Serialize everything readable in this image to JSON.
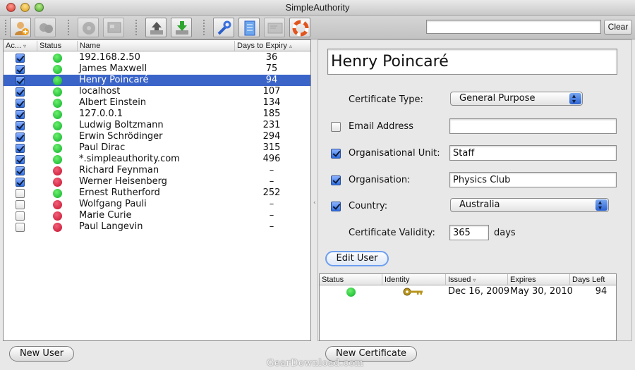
{
  "window": {
    "title": "SimpleAuthority"
  },
  "toolbar": {
    "buttons": [
      {
        "icon": "new-user-icon"
      },
      {
        "icon": "users-disabled-icon"
      },
      {
        "icon": "disk-disabled-icon"
      },
      {
        "icon": "screen-disabled-icon"
      },
      {
        "icon": "upload-icon"
      },
      {
        "icon": "download-icon"
      },
      {
        "icon": "tools-icon"
      },
      {
        "icon": "certificate-scroll-icon"
      },
      {
        "icon": "certificate-card-icon"
      },
      {
        "icon": "lifebuoy-help-icon"
      }
    ],
    "search_value": "",
    "clear_label": "Clear"
  },
  "users_table": {
    "columns": [
      "Ac...",
      "Status",
      "Name",
      "Days to Expiry"
    ],
    "rows": [
      {
        "active": true,
        "status": "green",
        "name": "192.168.2.50",
        "days": "36",
        "selected": false
      },
      {
        "active": true,
        "status": "green",
        "name": "James Maxwell",
        "days": "75",
        "selected": false
      },
      {
        "active": true,
        "status": "green",
        "name": "Henry Poincaré",
        "days": "94",
        "selected": true
      },
      {
        "active": true,
        "status": "green",
        "name": "localhost",
        "days": "107",
        "selected": false
      },
      {
        "active": true,
        "status": "green",
        "name": "Albert Einstein",
        "days": "134",
        "selected": false
      },
      {
        "active": true,
        "status": "green",
        "name": "127.0.0.1",
        "days": "185",
        "selected": false
      },
      {
        "active": true,
        "status": "green",
        "name": "Ludwig Boltzmann",
        "days": "231",
        "selected": false
      },
      {
        "active": true,
        "status": "green",
        "name": "Erwin Schrödinger",
        "days": "294",
        "selected": false
      },
      {
        "active": true,
        "status": "green",
        "name": "Paul Dirac",
        "days": "315",
        "selected": false
      },
      {
        "active": true,
        "status": "green",
        "name": "*.simpleauthority.com",
        "days": "496",
        "selected": false
      },
      {
        "active": true,
        "status": "red",
        "name": "Richard Feynman",
        "days": "–",
        "selected": false
      },
      {
        "active": true,
        "status": "red",
        "name": "Werner Heisenberg",
        "days": "–",
        "selected": false
      },
      {
        "active": false,
        "status": "green",
        "name": "Ernest Rutherford",
        "days": "252",
        "selected": false
      },
      {
        "active": false,
        "status": "red",
        "name": "Wolfgang Pauli",
        "days": "–",
        "selected": false
      },
      {
        "active": false,
        "status": "red",
        "name": "Marie Curie",
        "days": "–",
        "selected": false
      },
      {
        "active": false,
        "status": "red",
        "name": "Paul Langevin",
        "days": "–",
        "selected": false
      }
    ]
  },
  "details": {
    "name": "Henry Poincaré",
    "cert_type_label": "Certificate Type:",
    "cert_type_value": "General Purpose",
    "email_label": "Email Address",
    "email_checked": false,
    "email_value": "",
    "ou_label": "Organisational Unit:",
    "ou_checked": true,
    "ou_value": "Staff",
    "org_label": "Organisation:",
    "org_checked": true,
    "org_value": "Physics Club",
    "country_label": "Country:",
    "country_checked": true,
    "country_value": "Australia",
    "validity_label": "Certificate Validity:",
    "validity_value": "365",
    "validity_unit": "days",
    "edit_user_label": "Edit User"
  },
  "cert_table": {
    "columns": [
      "Status",
      "Identity",
      "Issued",
      "Expires",
      "Days Left"
    ],
    "rows": [
      {
        "status": "green",
        "identity_icon": "key-icon",
        "issued": "Dec 16, 2009",
        "expires": "May 30, 2010",
        "days_left": "94"
      }
    ]
  },
  "footer": {
    "new_user_label": "New User",
    "new_certificate_label": "New Certificate"
  },
  "watermark": "GearDownload.com",
  "colors": {
    "selection": "#3a64c8",
    "status_green": "#0cae2a",
    "status_red": "#c4102c"
  }
}
